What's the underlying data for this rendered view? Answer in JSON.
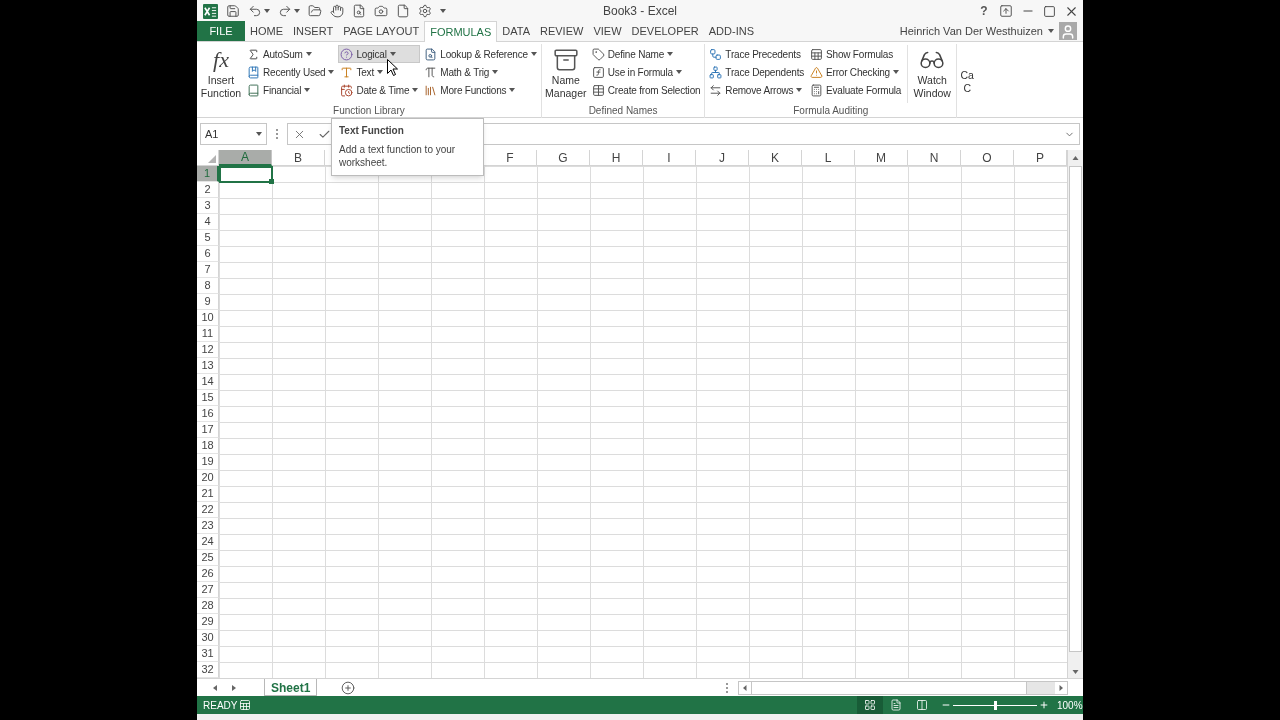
{
  "window": {
    "title": "Book3 - Excel",
    "help": "?"
  },
  "tabs": [
    {
      "label": "FILE",
      "kind": "file",
      "selected": false
    },
    {
      "label": "HOME",
      "kind": "tab",
      "selected": false
    },
    {
      "label": "INSERT",
      "kind": "tab",
      "selected": false
    },
    {
      "label": "PAGE LAYOUT",
      "kind": "tab",
      "selected": false
    },
    {
      "label": "FORMULAS",
      "kind": "tab",
      "selected": true
    },
    {
      "label": "DATA",
      "kind": "tab",
      "selected": false
    },
    {
      "label": "REVIEW",
      "kind": "tab",
      "selected": false
    },
    {
      "label": "VIEW",
      "kind": "tab",
      "selected": false
    },
    {
      "label": "DEVELOPER",
      "kind": "tab",
      "selected": false
    },
    {
      "label": "ADD-INS",
      "kind": "tab",
      "selected": false
    }
  ],
  "account": {
    "name": "Heinrich Van Der Westhuizen"
  },
  "ribbon": {
    "groups": [
      {
        "label": "Function Library",
        "items": [
          {
            "kind": "large",
            "label": "Insert Function",
            "symbol": "fx"
          },
          {
            "kind": "stack",
            "buttons": [
              {
                "label": "AutoSum",
                "dropdown": true,
                "highlighted": false
              },
              {
                "label": "Recently Used",
                "dropdown": true,
                "highlighted": false
              },
              {
                "label": "Financial",
                "dropdown": true,
                "highlighted": false
              }
            ]
          },
          {
            "kind": "stack",
            "buttons": [
              {
                "label": "Logical",
                "dropdown": true,
                "highlighted": true
              },
              {
                "label": "Text",
                "dropdown": true,
                "highlighted": false
              },
              {
                "label": "Date & Time",
                "dropdown": true,
                "highlighted": false
              }
            ]
          },
          {
            "kind": "stack",
            "buttons": [
              {
                "label": "Lookup & Reference",
                "dropdown": true,
                "highlighted": false
              },
              {
                "label": "Math & Trig",
                "dropdown": true,
                "highlighted": false
              },
              {
                "label": "More Functions",
                "dropdown": true,
                "highlighted": false
              }
            ]
          }
        ]
      },
      {
        "label": "Defined Names",
        "items": [
          {
            "kind": "large",
            "label": "Name Manager"
          },
          {
            "kind": "stack",
            "buttons": [
              {
                "label": "Define Name",
                "dropdown": true,
                "highlighted": false
              },
              {
                "label": "Use in Formula",
                "dropdown": true,
                "highlighted": false
              },
              {
                "label": "Create from Selection",
                "dropdown": false,
                "highlighted": false
              }
            ]
          }
        ]
      },
      {
        "label": "Formula Auditing",
        "items": [
          {
            "kind": "stack",
            "buttons": [
              {
                "label": "Trace Precedents",
                "dropdown": false,
                "highlighted": false
              },
              {
                "label": "Trace Dependents",
                "dropdown": false,
                "highlighted": false
              },
              {
                "label": "Remove Arrows",
                "dropdown": true,
                "highlighted": false
              }
            ]
          },
          {
            "kind": "stack",
            "buttons": [
              {
                "label": "Show Formulas",
                "dropdown": false,
                "highlighted": false
              },
              {
                "label": "Error Checking",
                "dropdown": true,
                "highlighted": false
              },
              {
                "label": "Evaluate Formula",
                "dropdown": false,
                "highlighted": false
              }
            ]
          },
          {
            "kind": "large",
            "label": "Watch Window"
          }
        ]
      },
      {
        "items": [
          {
            "kind": "large",
            "label": "Ca C"
          }
        ]
      }
    ]
  },
  "formula_bar": {
    "name_box": "A1"
  },
  "tooltip": {
    "title": "Text Function",
    "text": "Add a text function to your worksheet."
  },
  "sheet": {
    "columns": [
      {
        "label": "A",
        "selected": true
      },
      {
        "label": "B",
        "selected": false
      },
      null,
      null,
      null,
      {
        "label": "F",
        "selected": false
      },
      {
        "label": "G",
        "selected": false
      },
      {
        "label": "H",
        "selected": false
      },
      {
        "label": "I",
        "selected": false
      },
      {
        "label": "J",
        "selected": false
      },
      {
        "label": "K",
        "selected": false
      },
      {
        "label": "L",
        "selected": false
      },
      {
        "label": "M",
        "selected": false
      },
      {
        "label": "N",
        "selected": false
      },
      {
        "label": "O",
        "selected": false
      },
      {
        "label": "P",
        "selected": false
      }
    ],
    "rows": [
      {
        "label": "1",
        "selected": true
      },
      {
        "label": "2",
        "selected": false
      },
      {
        "label": "3",
        "selected": false
      },
      {
        "label": "4",
        "selected": false
      },
      {
        "label": "5",
        "selected": false
      },
      {
        "label": "6",
        "selected": false
      },
      {
        "label": "7",
        "selected": false
      },
      {
        "label": "8",
        "selected": false
      },
      {
        "label": "9",
        "selected": false
      },
      {
        "label": "10",
        "selected": false
      },
      {
        "label": "11",
        "selected": false
      },
      {
        "label": "12",
        "selected": false
      },
      {
        "label": "13",
        "selected": false
      },
      {
        "label": "14",
        "selected": false
      },
      {
        "label": "15",
        "selected": false
      },
      {
        "label": "16",
        "selected": false
      },
      {
        "label": "17",
        "selected": false
      },
      {
        "label": "18",
        "selected": false
      },
      {
        "label": "19",
        "selected": false
      },
      {
        "label": "20",
        "selected": false
      },
      {
        "label": "21",
        "selected": false
      },
      {
        "label": "22",
        "selected": false
      },
      {
        "label": "23",
        "selected": false
      },
      {
        "label": "24",
        "selected": false
      },
      {
        "label": "25",
        "selected": false
      },
      {
        "label": "26",
        "selected": false
      },
      {
        "label": "27",
        "selected": false
      },
      {
        "label": "28",
        "selected": false
      },
      {
        "label": "29",
        "selected": false
      },
      {
        "label": "30",
        "selected": false
      },
      {
        "label": "31",
        "selected": false
      },
      {
        "label": "32",
        "selected": false
      }
    ]
  },
  "sheet_tabs": [
    {
      "label": "Sheet1",
      "selected": true
    }
  ],
  "status_bar": {
    "status": "READY",
    "views": [
      {
        "selected": true
      },
      {
        "selected": false
      },
      {
        "selected": false
      }
    ],
    "zoom": {
      "level": 0.5,
      "reading": "100%"
    }
  }
}
